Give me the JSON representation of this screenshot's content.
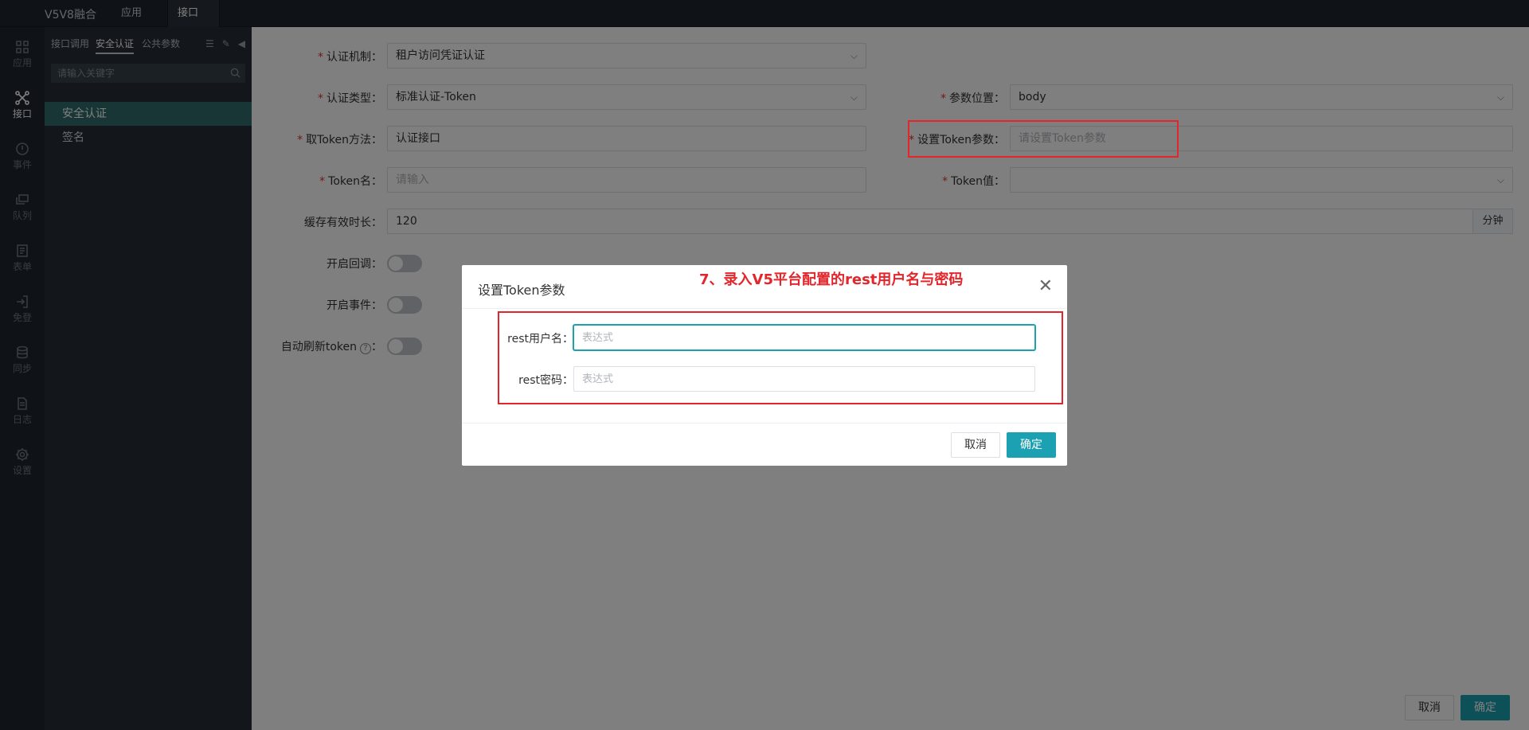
{
  "topbar": {
    "app_title": "V5V8融合",
    "tabs": [
      {
        "label": "应用"
      },
      {
        "label": "接口",
        "close": "✕"
      }
    ]
  },
  "rail": {
    "items": [
      {
        "label": "应用",
        "icon": "grid-icon"
      },
      {
        "label": "接口",
        "icon": "network-icon",
        "active": true
      },
      {
        "label": "事件",
        "icon": "alert-icon"
      },
      {
        "label": "队列",
        "icon": "queue-icon"
      },
      {
        "label": "表单",
        "icon": "form-icon"
      },
      {
        "label": "免登",
        "icon": "login-icon"
      },
      {
        "label": "同步",
        "icon": "database-icon"
      },
      {
        "label": "日志",
        "icon": "file-icon"
      },
      {
        "label": "设置",
        "icon": "gear-icon"
      }
    ]
  },
  "panel": {
    "tabs": [
      {
        "label": "接口调用"
      },
      {
        "label": "安全认证",
        "active": true
      },
      {
        "label": "公共参数"
      }
    ],
    "search_placeholder": "请输入关键字",
    "items": [
      {
        "label": "安全认证",
        "active": true
      },
      {
        "label": "签名"
      }
    ]
  },
  "form": {
    "auth_mechanism": {
      "label": "认证机制",
      "value": "租户访问凭证认证"
    },
    "auth_type": {
      "label": "认证类型",
      "value": "标准认证-Token"
    },
    "param_position": {
      "label": "参数位置",
      "value": "body"
    },
    "token_method": {
      "label": "取Token方法",
      "value": "认证接口"
    },
    "token_params": {
      "label": "设置Token参数",
      "placeholder": "请设置Token参数"
    },
    "token_name": {
      "label": "Token名",
      "placeholder": "请输入"
    },
    "token_value": {
      "label": "Token值",
      "value": ""
    },
    "cache_duration": {
      "label": "缓存有效时长",
      "value": "120",
      "unit": "分钟"
    },
    "callback": {
      "label": "开启回调",
      "enabled": false
    },
    "event": {
      "label": "开启事件",
      "enabled": false
    },
    "auto_refresh": {
      "label": "自动刷新token",
      "enabled": false,
      "help": "?"
    }
  },
  "footer": {
    "cancel": "取消",
    "confirm": "确定"
  },
  "dialog": {
    "title": "设置Token参数",
    "note": "7、录入V5平台配置的rest用户名与密码",
    "username": {
      "label": "rest用户名",
      "placeholder": "表达式",
      "value": ""
    },
    "password": {
      "label": "rest密码",
      "placeholder": "表达式",
      "value": ""
    },
    "cancel": "取消",
    "confirm": "确定",
    "close": "✕"
  },
  "colors": {
    "accent": "#1ba1b1",
    "highlight": "#e3262c",
    "required": "#e0342f"
  }
}
